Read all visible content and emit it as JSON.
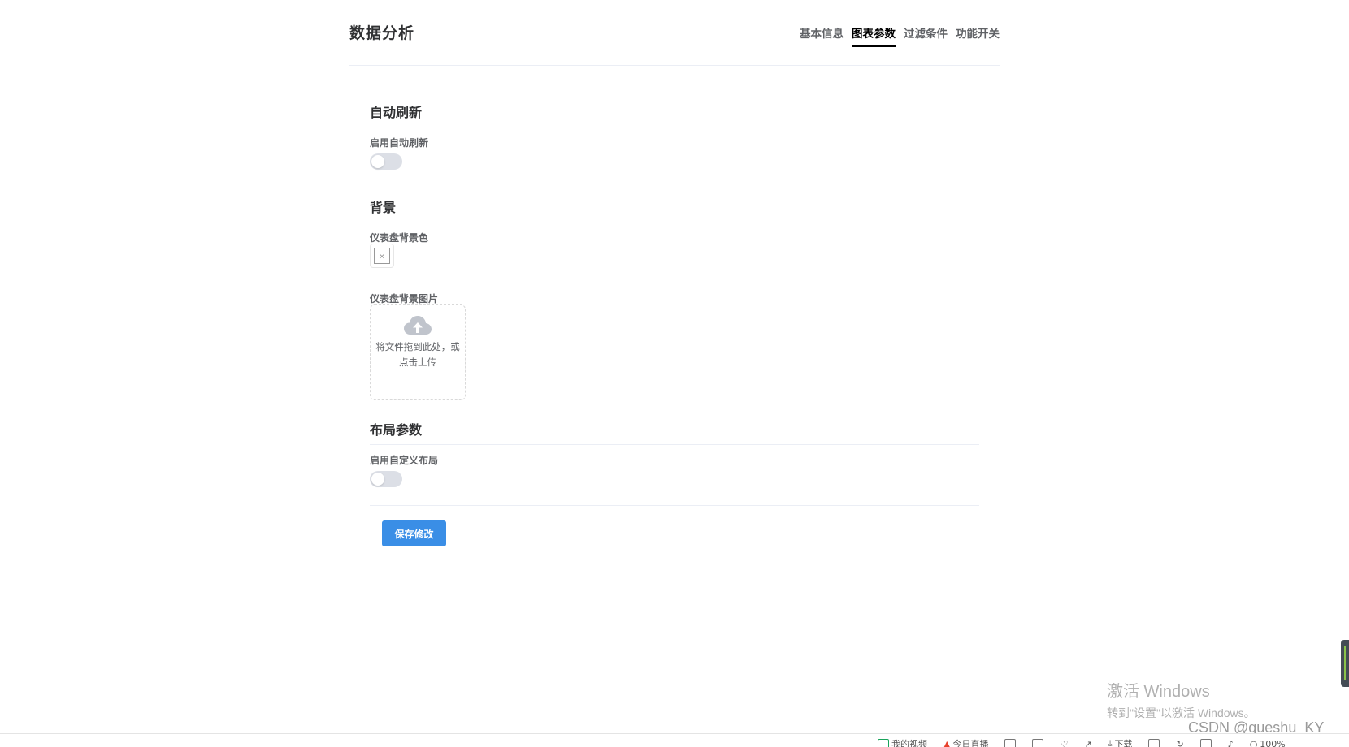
{
  "header": {
    "title": "数据分析",
    "tabs": [
      {
        "label": "基本信息",
        "active": false
      },
      {
        "label": "图表参数",
        "active": true
      },
      {
        "label": "过滤条件",
        "active": false
      },
      {
        "label": "功能开关",
        "active": false
      }
    ]
  },
  "sections": {
    "auto_refresh": {
      "title": "自动刷新",
      "enable_label": "启用自动刷新",
      "enabled": false
    },
    "background": {
      "title": "背景",
      "color_label": "仪表盘背景色",
      "color_empty_glyph": "×",
      "image_label": "仪表盘背景图片",
      "upload_text": "将文件拖到此处，或点击上传"
    },
    "layout": {
      "title": "布局参数",
      "enable_label": "启用自定义布局",
      "enabled": false
    }
  },
  "actions": {
    "save_label": "保存修改"
  },
  "watermark": {
    "line1": "激活 Windows",
    "line2": "转到\"设置\"以激活 Windows。",
    "csdn": "CSDN @queshu_KY"
  },
  "taskbar": {
    "items": [
      "我的视频",
      "今日直播",
      "下载",
      "100%"
    ]
  },
  "colors": {
    "accent": "#3a8ee6",
    "switch_off": "#dcdfe6",
    "divider": "#ebeef5"
  }
}
